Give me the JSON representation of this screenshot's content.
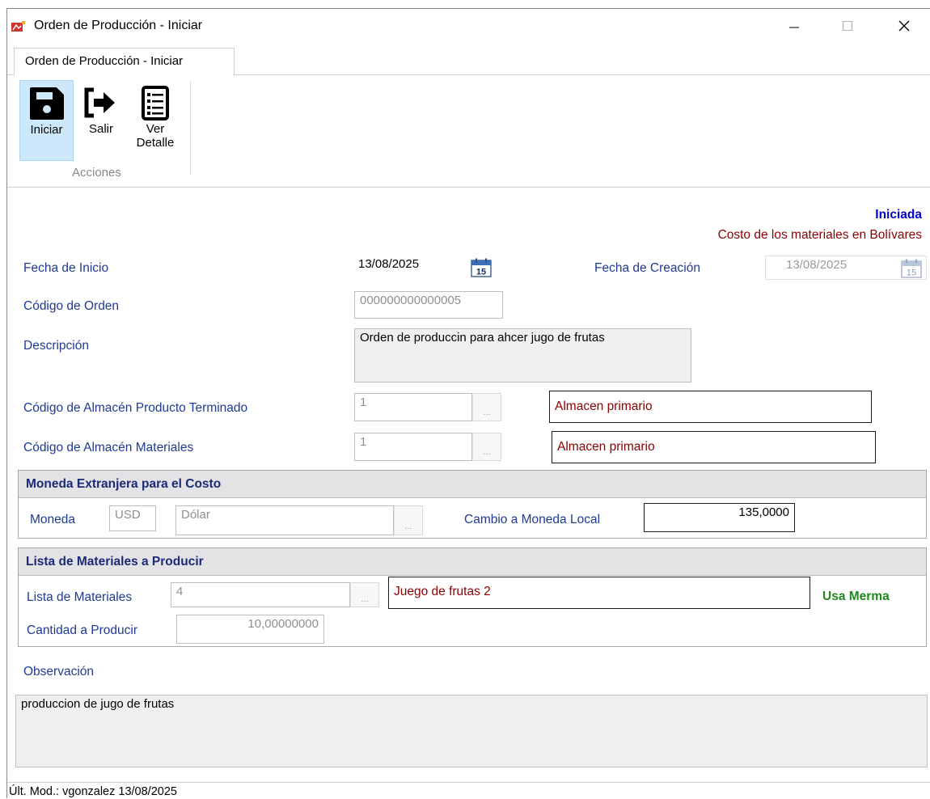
{
  "window": {
    "title": "Orden de Producción - Iniciar"
  },
  "tab": {
    "label": "Orden de Producción - Iniciar"
  },
  "toolbar": {
    "iniciar_label": "Iniciar",
    "salir_label": "Salir",
    "detalle_label": "Ver\nDetalle",
    "group_label": "Acciones"
  },
  "header": {
    "status": "Iniciada",
    "cost_note": "Costo de los materiales en Bolívares"
  },
  "form": {
    "fecha_inicio_label": "Fecha de Inicio",
    "fecha_inicio_value": "13/08/2025",
    "fecha_creacion_label": "Fecha de Creación",
    "fecha_creacion_value": "13/08/2025",
    "codigo_orden_label": "Código de Orden",
    "codigo_orden_value": "000000000000005",
    "descripcion_label": "Descripción",
    "descripcion_value": "Orden de produccin para ahcer jugo de frutas",
    "almacen_terminado_label": "Código de Almacén Producto Terminado",
    "almacen_terminado_code": "1",
    "almacen_terminado_name": "Almacen primario",
    "almacen_materiales_label": "Código de Almacén Materiales",
    "almacen_materiales_code": "1",
    "almacen_materiales_name": "Almacen primario",
    "ellipsis": "..."
  },
  "moneda_group": {
    "title": "Moneda Extranjera para el Costo",
    "moneda_label": "Moneda",
    "moneda_code": "USD",
    "moneda_name": "Dólar",
    "cambio_label": "Cambio a Moneda Local",
    "cambio_value": "135,0000"
  },
  "lista_group": {
    "title": "Lista de Materiales a Producir",
    "lista_label": "Lista de Materiales",
    "lista_code": "4",
    "lista_name": "Juego de frutas 2",
    "usa_merma": "Usa Merma",
    "cantidad_label": "Cantidad a Producir",
    "cantidad_value": "10,00000000"
  },
  "observacion": {
    "label": "Observación",
    "value": "produccion de jugo de frutas"
  },
  "status_bar": {
    "text": "Últ. Mod.:  vgonzalez  13/08/2025"
  },
  "calendar": {
    "day": "15"
  },
  "colors": {
    "label_blue": "#1f3a93",
    "status_blue": "#0000cc",
    "dark_red": "#8b0000",
    "green": "#1e8a1e",
    "ribbon_selected": "#cde8fb"
  }
}
